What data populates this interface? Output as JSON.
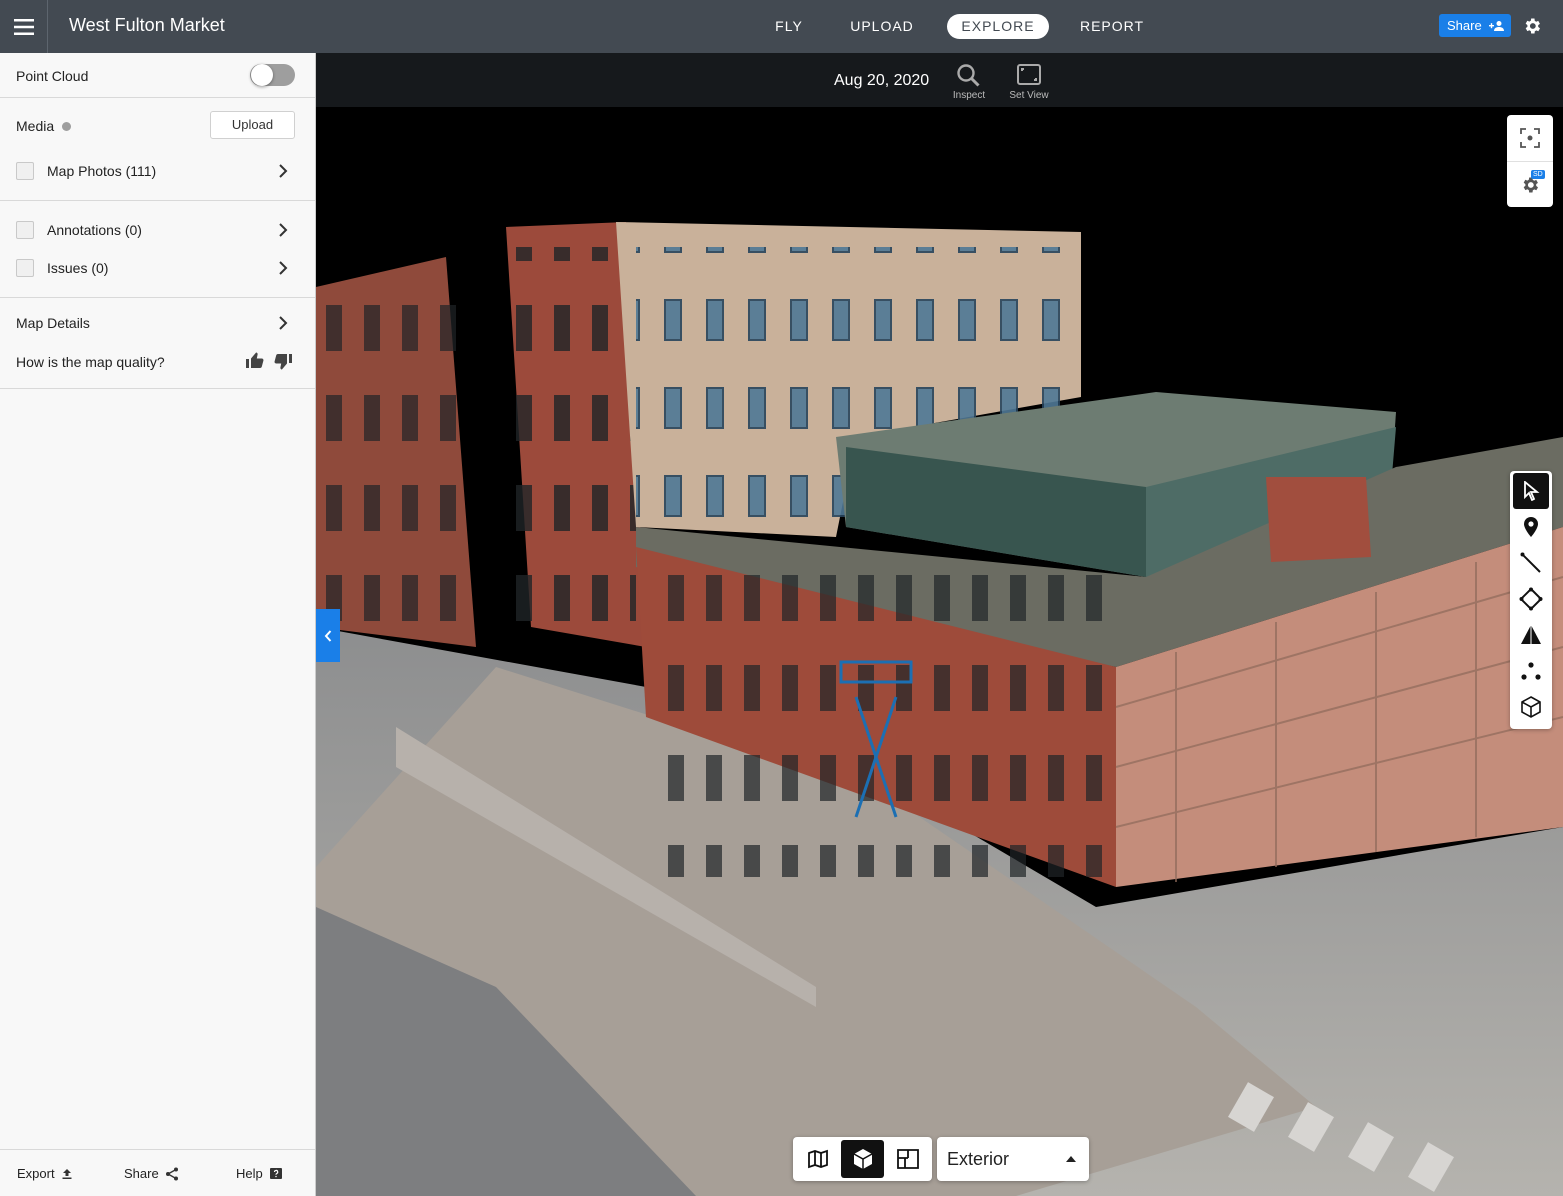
{
  "app": {
    "title": "West Fulton Market",
    "share_label": "Share"
  },
  "nav": {
    "tabs": [
      {
        "label": "FLY"
      },
      {
        "label": "UPLOAD"
      },
      {
        "label": "EXPLORE",
        "active": true
      },
      {
        "label": "REPORT"
      }
    ]
  },
  "sidebar": {
    "point_cloud_label": "Point Cloud",
    "point_cloud_on": false,
    "media_label": "Media",
    "upload_label": "Upload",
    "map_photos_label": "Map Photos (111)",
    "annotations_label": "Annotations (0)",
    "issues_label": "Issues (0)",
    "map_details_label": "Map Details",
    "quality_question": "How is the map quality?",
    "footer": {
      "export_label": "Export",
      "share_label": "Share",
      "help_label": "Help"
    }
  },
  "viewer": {
    "date": "Aug 20, 2020",
    "inspect_label": "Inspect",
    "set_view_label": "Set View",
    "sd_badge": "SD",
    "view_mode_value": "Exterior"
  },
  "colors": {
    "topbar": "#434a52",
    "accent": "#1a7fe8",
    "sidebar_bg": "#f8f8f8"
  }
}
